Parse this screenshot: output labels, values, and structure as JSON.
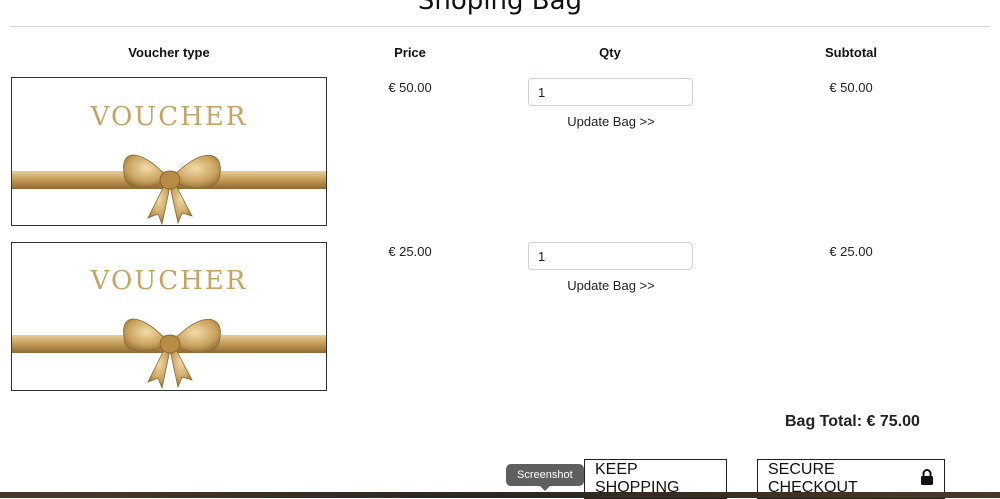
{
  "page": {
    "title": "Shoping Bag"
  },
  "table": {
    "headers": {
      "voucher_type": "Voucher type",
      "price": "Price",
      "qty": "Qty",
      "subtotal": "Subtotal"
    },
    "rows": [
      {
        "image_text": "VOUCHER",
        "price": "€ 50.00",
        "qty": "1",
        "update_label": "Update Bag >>",
        "subtotal": "€ 50.00"
      },
      {
        "image_text": "VOUCHER",
        "price": "€ 25.00",
        "qty": "1",
        "update_label": "Update Bag >>",
        "subtotal": "€ 25.00"
      }
    ]
  },
  "summary": {
    "bag_total": "Bag Total: € 75.00"
  },
  "actions": {
    "keep_shopping": "KEEP SHOPPING",
    "secure_checkout": "SECURE CHECKOUT",
    "checkout_icon": "lock-icon"
  },
  "tooltip": {
    "text": "Screenshot"
  },
  "colors": {
    "gold": "#c8a463",
    "gold_dark": "#9a7336",
    "tooltip_bg": "#5f5f5f"
  }
}
